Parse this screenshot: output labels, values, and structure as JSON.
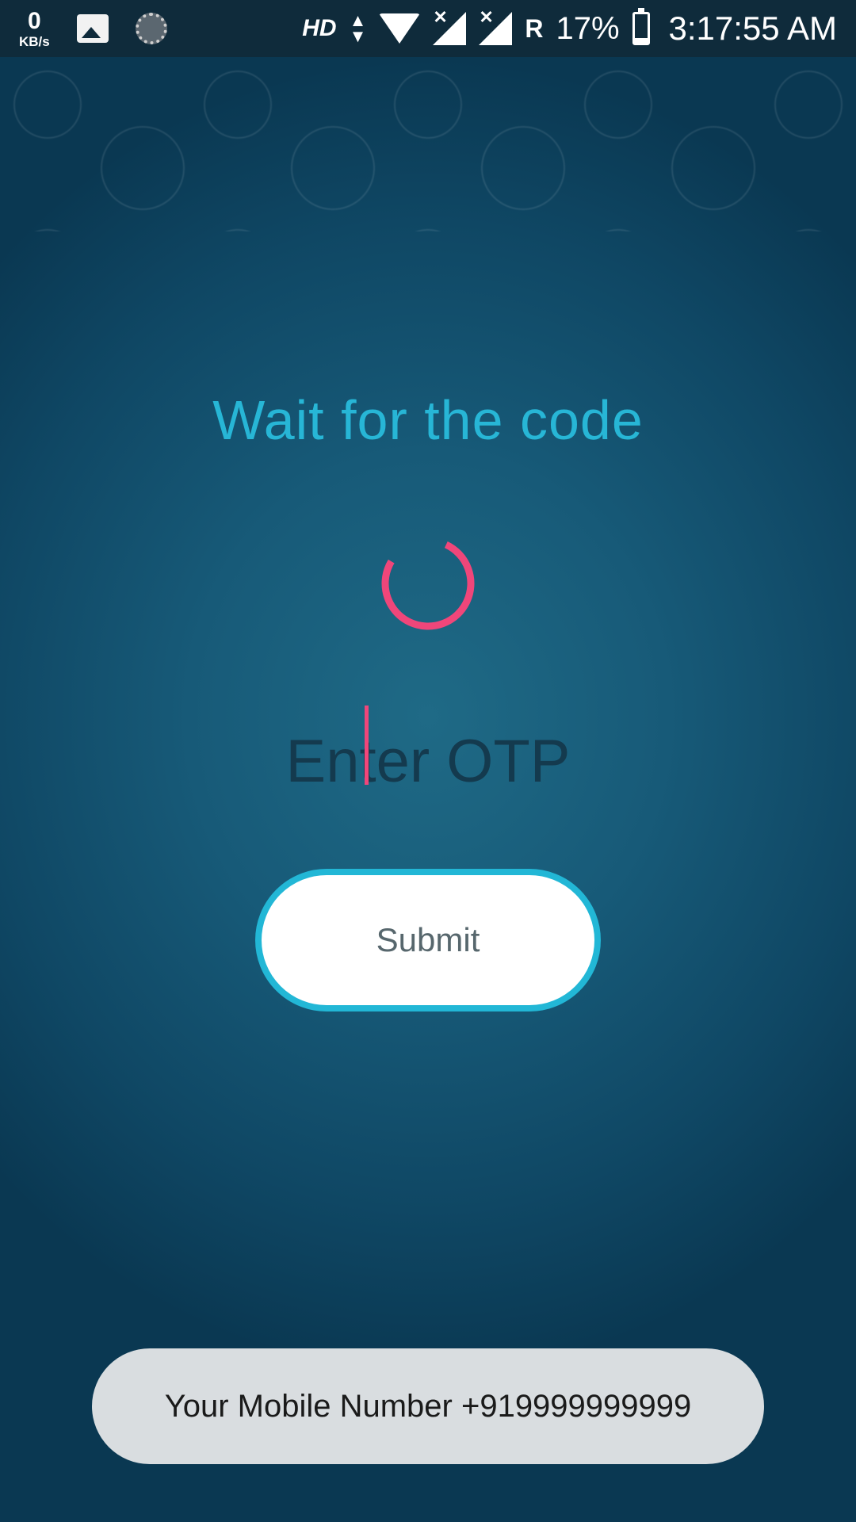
{
  "status_bar": {
    "net_speed_value": "0",
    "net_speed_unit": "KB/s",
    "network_type": "HD",
    "roaming": "R",
    "battery_percent": "17%",
    "time": "3:17:55 AM",
    "icons": [
      "image-icon",
      "sync-spinner-icon",
      "data-arrows-icon",
      "wifi-icon",
      "signal-icon",
      "signal-icon",
      "battery-charging-icon"
    ]
  },
  "main": {
    "title": "Wait for the code",
    "otp_placeholder": "Enter OTP",
    "otp_value": "",
    "submit_label": "Submit",
    "toast_message": "Your Mobile Number +919999999999"
  },
  "colors": {
    "title": "#27b6d6",
    "loader": "#f0467a",
    "button_border": "#22b7d6",
    "background": "#175a78"
  }
}
